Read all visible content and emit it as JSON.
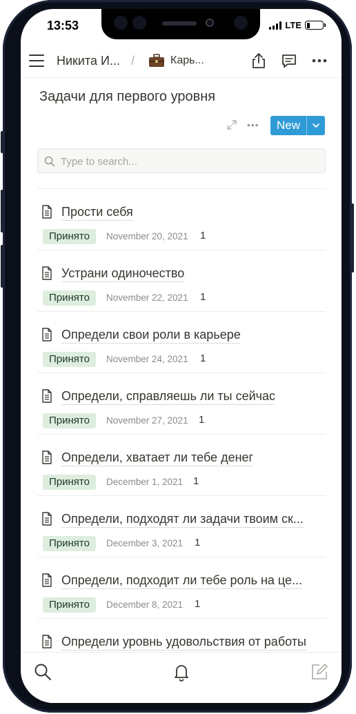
{
  "status_bar": {
    "time": "13:53",
    "network": "LTE"
  },
  "top_bar": {
    "breadcrumb_user": "Никита И...",
    "breadcrumb_separator": "/",
    "breadcrumb_page": "Карь..."
  },
  "page": {
    "title": "Задачи для первого уровня"
  },
  "toolbar": {
    "new_label": "New",
    "more_label": "•••"
  },
  "search": {
    "placeholder": "Type to search..."
  },
  "items": [
    {
      "title": "Прости себя",
      "status": "Принято",
      "date": "November 20, 2021",
      "count": "1"
    },
    {
      "title": "Устрани одиночество",
      "status": "Принято",
      "date": "November 22, 2021",
      "count": "1"
    },
    {
      "title": "Определи свои роли в карьере",
      "status": "Принято",
      "date": "November 24, 2021",
      "count": "1"
    },
    {
      "title": "Определи, справляешь ли ты сейчас",
      "status": "Принято",
      "date": "November 27, 2021",
      "count": "1"
    },
    {
      "title": "Определи, хватает ли тебе денег",
      "status": "Принято",
      "date": "December 1, 2021",
      "count": "1"
    },
    {
      "title": "Определи, подходят ли задачи твоим ск...",
      "status": "Принято",
      "date": "December 3, 2021",
      "count": "1"
    },
    {
      "title": "Определи, подходит ли тебе роль на це...",
      "status": "Принято",
      "date": "December 8, 2021",
      "count": "1"
    },
    {
      "title": "Определи уровнь удовольствия от работы",
      "status": "",
      "date": "",
      "count": ""
    }
  ],
  "colors": {
    "accent": "#2f9bd6",
    "tag_bg": "#ddedde",
    "text": "#37352f"
  },
  "icons": [
    "menu-icon",
    "briefcase-icon",
    "share-icon",
    "comments-icon",
    "more-icon",
    "expand-icon",
    "search-icon",
    "document-icon",
    "bell-icon",
    "edit-icon"
  ]
}
